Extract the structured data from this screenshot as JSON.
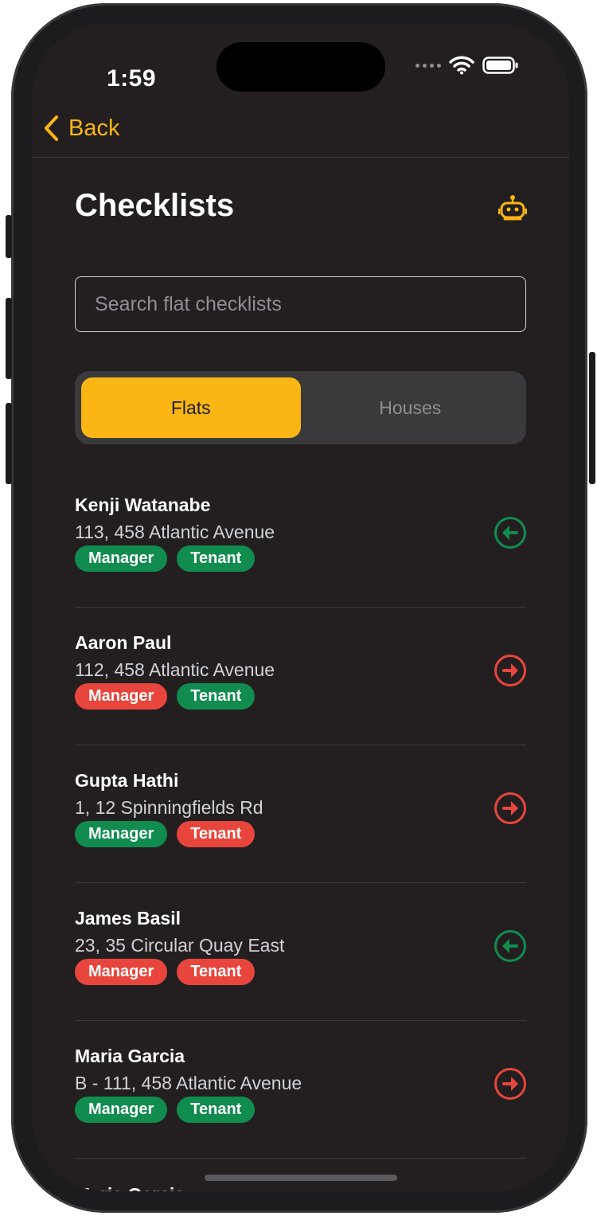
{
  "status_bar": {
    "time": "1:59"
  },
  "nav": {
    "back_label": "Back"
  },
  "page": {
    "title": "Checklists"
  },
  "search": {
    "placeholder": "Search flat checklists",
    "value": ""
  },
  "segments": [
    {
      "label": "Flats",
      "active": true
    },
    {
      "label": "Houses",
      "active": false
    }
  ],
  "checklists": [
    {
      "name": "Kenji Watanabe",
      "address": "113, 458 Atlantic Avenue",
      "tags": [
        {
          "label": "Manager",
          "color": "#118c4f"
        },
        {
          "label": "Tenant",
          "color": "#118c4f"
        }
      ],
      "action": {
        "icon": "arrow-left-circle-icon",
        "color": "#118c4f"
      }
    },
    {
      "name": "Aaron Paul",
      "address": "112, 458 Atlantic Avenue",
      "tags": [
        {
          "label": "Manager",
          "color": "#e8463c"
        },
        {
          "label": "Tenant",
          "color": "#118c4f"
        }
      ],
      "action": {
        "icon": "arrow-right-circle-icon",
        "color": "#e8463c"
      }
    },
    {
      "name": "Gupta Hathi",
      "address": "1, 12 Spinningfields Rd",
      "tags": [
        {
          "label": "Manager",
          "color": "#118c4f"
        },
        {
          "label": "Tenant",
          "color": "#e8463c"
        }
      ],
      "action": {
        "icon": "arrow-right-circle-icon",
        "color": "#e8463c"
      }
    },
    {
      "name": "James Basil",
      "address": "23, 35 Circular Quay East",
      "tags": [
        {
          "label": "Manager",
          "color": "#e8463c"
        },
        {
          "label": "Tenant",
          "color": "#e8463c"
        }
      ],
      "action": {
        "icon": "arrow-left-circle-icon",
        "color": "#118c4f"
      }
    },
    {
      "name": "Maria Garcia",
      "address": "B - 111, 458 Atlantic Avenue",
      "tags": [
        {
          "label": "Manager",
          "color": "#118c4f"
        },
        {
          "label": "Tenant",
          "color": "#118c4f"
        }
      ],
      "action": {
        "icon": "arrow-right-circle-icon",
        "color": "#e8463c"
      }
    }
  ],
  "partial_row": {
    "name": "Maria Garcia"
  },
  "colors": {
    "accent": "#fbb614",
    "background": "#231f20",
    "success": "#118c4f",
    "danger": "#e8463c"
  }
}
